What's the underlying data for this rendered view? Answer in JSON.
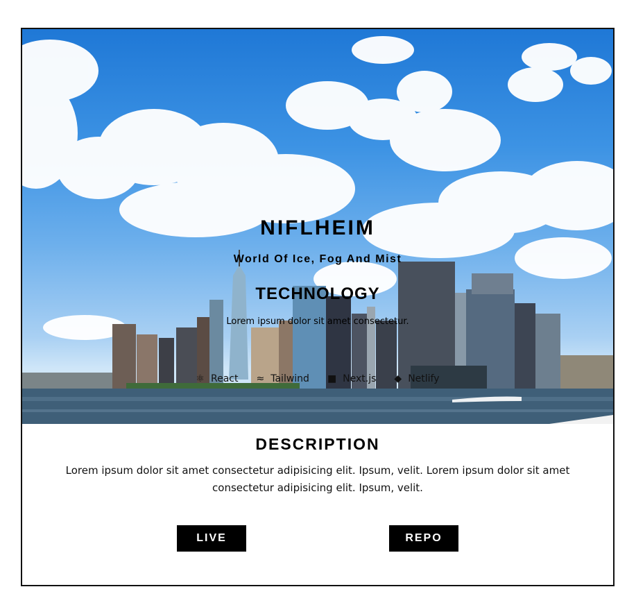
{
  "project": {
    "title": "NIFLHEIM",
    "subtitle": "World Of Ice, Fog And Mist"
  },
  "technology": {
    "heading": "TECHNOLOGY",
    "description": "Lorem ipsum dolor sit amet consectetur.",
    "items": [
      {
        "label": "React",
        "icon": "react-icon"
      },
      {
        "label": "Tailwind",
        "icon": "tailwind-icon"
      },
      {
        "label": "Next.js",
        "icon": "nextjs-icon"
      },
      {
        "label": "Netlify",
        "icon": "netlify-icon"
      }
    ]
  },
  "description": {
    "heading": "DESCRIPTION",
    "body": "Lorem ipsum dolor sit amet consectetur adipisicing elit. Ipsum, velit. Lorem ipsum dolor sit amet consectetur adipisicing elit. Ipsum, velit."
  },
  "actions": {
    "live_label": "LIVE",
    "repo_label": "REPO"
  },
  "colors": {
    "button_bg": "#000000",
    "button_text": "#ffffff",
    "sky": "#3d93e4",
    "water": "#3f5f78"
  }
}
